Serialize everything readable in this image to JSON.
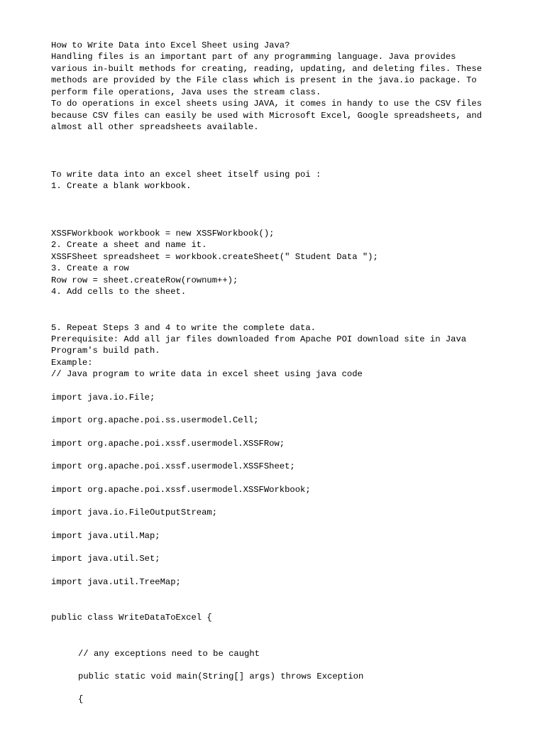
{
  "title": "How to Write Data into Excel Sheet using Java?",
  "intro1": "Handling files is an important part of any programming language. Java provides various in-built methods for creating, reading, updating, and deleting files. These methods are provided by the File class which is present in the java.io package. To perform file operations, Java uses the stream class.",
  "intro2": "To do operations in excel sheets using JAVA, it comes in handy to use the CSV files because CSV files can easily be used with Microsoft Excel, Google spreadsheets, and almost all other spreadsheets available.",
  "steps_intro": "To write data into an excel sheet itself using poi :",
  "step1": "1. Create a blank workbook.",
  "code1": "XSSFWorkbook workbook = new XSSFWorkbook();",
  "step2": "2. Create a sheet and name it.",
  "code2": "XSSFSheet spreadsheet = workbook.createSheet(\" Student Data \");",
  "step3": "3. Create a row",
  "code3": "Row row = sheet.createRow(rownum++);",
  "step4": "4. Add cells to the sheet.",
  "step5": "5. Repeat Steps 3 and 4 to write the complete data.",
  "prereq": "Prerequisite: Add all jar files downloaded from Apache POI download site in Java Program's build path.",
  "example_label": "Example:",
  "comment1": "// Java program to write data in excel sheet using java code",
  "imp1": "import java.io.File;",
  "imp2": "import org.apache.poi.ss.usermodel.Cell;",
  "imp3": "import org.apache.poi.xssf.usermodel.XSSFRow;",
  "imp4": "import org.apache.poi.xssf.usermodel.XSSFSheet;",
  "imp5": "import org.apache.poi.xssf.usermodel.XSSFWorkbook;",
  "imp6": "import java.io.FileOutputStream;",
  "imp7": "import java.util.Map;",
  "imp8": "import java.util.Set;",
  "imp9": "import java.util.TreeMap;",
  "class_decl": "public class WriteDataToExcel {",
  "comment2": "// any exceptions need to be caught",
  "main_decl": "public static void main(String[] args) throws Exception",
  "brace": "{"
}
